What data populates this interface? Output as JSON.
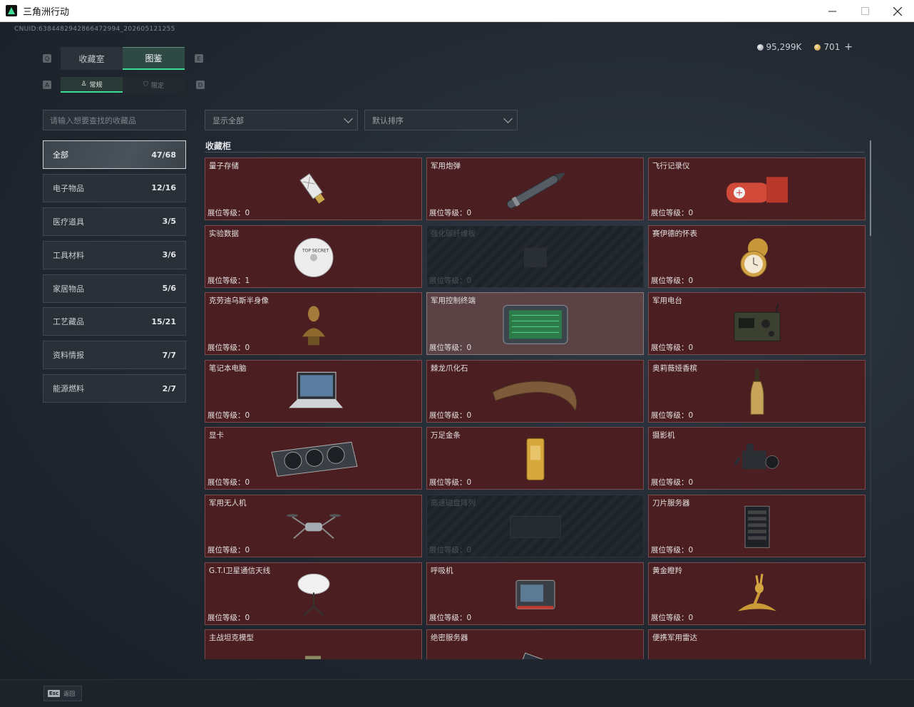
{
  "window": {
    "title": "三角洲行动"
  },
  "uid": "CNUID:6384482942866472994_202605121255",
  "currency": {
    "silver": "95,299K",
    "gold": "701"
  },
  "tabs": [
    {
      "label": "收藏室",
      "active": false
    },
    {
      "label": "图鉴",
      "active": true
    }
  ],
  "subtabs": [
    {
      "label": "常规",
      "active": true
    },
    {
      "label": "限定",
      "active": false
    }
  ],
  "search": {
    "placeholder": "请输入想要查找的收藏品"
  },
  "categories": [
    {
      "label": "全部",
      "count": "47/68"
    },
    {
      "label": "电子物品",
      "count": "12/16"
    },
    {
      "label": "医疗道具",
      "count": "3/5"
    },
    {
      "label": "工具材料",
      "count": "3/6"
    },
    {
      "label": "家居物品",
      "count": "5/6"
    },
    {
      "label": "工艺藏品",
      "count": "15/21"
    },
    {
      "label": "资料情报",
      "count": "7/7"
    },
    {
      "label": "能源燃料",
      "count": "2/7"
    }
  ],
  "filters": {
    "show": "显示全部",
    "sort": "默认排序"
  },
  "section": {
    "title": "收藏柜"
  },
  "level_prefix": "展位等级：",
  "items": [
    {
      "name": "量子存储",
      "level": "0",
      "icon": "usb-drive-icon"
    },
    {
      "name": "军用炮弹",
      "level": "0",
      "icon": "artillery-shell-icon"
    },
    {
      "name": "飞行记录仪",
      "level": "0",
      "icon": "flight-recorder-icon"
    },
    {
      "name": "实验数据",
      "level": "1",
      "icon": "data-disc-icon"
    },
    {
      "name": "强化碳纤维板",
      "level": "0",
      "icon": "carbon-plate-icon",
      "locked": true
    },
    {
      "name": "赛伊德的怀表",
      "level": "0",
      "icon": "pocket-watch-icon"
    },
    {
      "name": "克劳迪乌斯半身像",
      "level": "0",
      "icon": "bust-statue-icon"
    },
    {
      "name": "军用控制终端",
      "level": "0",
      "icon": "control-terminal-icon",
      "highlight": true
    },
    {
      "name": "军用电台",
      "level": "0",
      "icon": "military-radio-icon"
    },
    {
      "name": "笔记本电脑",
      "level": "0",
      "icon": "laptop-icon"
    },
    {
      "name": "棘龙爪化石",
      "level": "0",
      "icon": "claw-fossil-icon"
    },
    {
      "name": "奥莉薇娅香槟",
      "level": "0",
      "icon": "champagne-bottle-icon"
    },
    {
      "name": "显卡",
      "level": "0",
      "icon": "graphics-card-icon"
    },
    {
      "name": "万足金条",
      "level": "0",
      "icon": "gold-bar-icon"
    },
    {
      "name": "摄影机",
      "level": "0",
      "icon": "video-camera-icon"
    },
    {
      "name": "军用无人机",
      "level": "0",
      "icon": "drone-icon"
    },
    {
      "name": "高速磁盘阵列",
      "level": "0",
      "icon": "disk-array-icon",
      "locked": true
    },
    {
      "name": "刀片服务器",
      "level": "0",
      "icon": "blade-server-icon"
    },
    {
      "name": "G.T.I卫星通信天线",
      "level": "0",
      "icon": "satellite-dish-icon"
    },
    {
      "name": "呼吸机",
      "level": "0",
      "icon": "ventilator-icon"
    },
    {
      "name": "黄金瞪羚",
      "level": "0",
      "icon": "golden-gazelle-icon"
    },
    {
      "name": "主战坦克模型",
      "level": "",
      "icon": "tank-model-icon"
    },
    {
      "name": "绝密服务器",
      "level": "",
      "icon": "secret-server-icon"
    },
    {
      "name": "便携军用雷达",
      "level": "",
      "icon": "portable-radar-icon"
    }
  ],
  "bottom": {
    "esc_key": "Esc",
    "esc_label": "返回"
  }
}
